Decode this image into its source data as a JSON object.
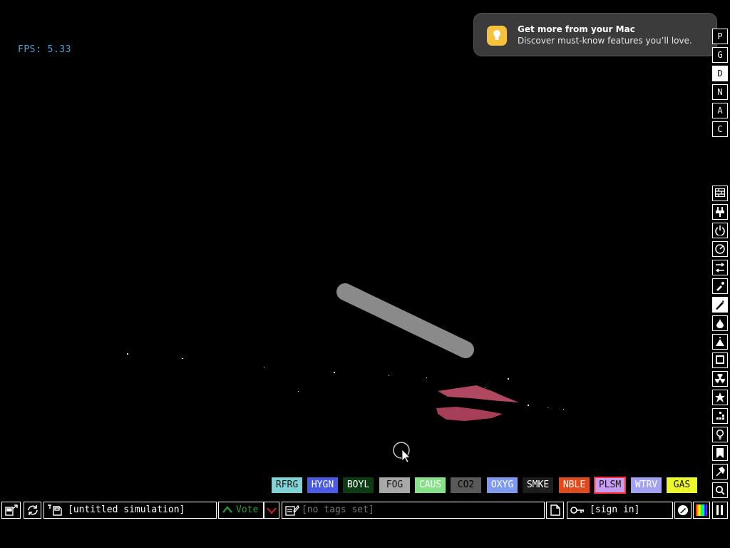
{
  "fps_label": "FPS: 5.33",
  "notification": {
    "title": "Get more from your Mac",
    "body": "Discover must-know features you’ll love.",
    "icon": "lightbulb-icon"
  },
  "display_modes": [
    "P",
    "G",
    "D",
    "N",
    "A",
    "C"
  ],
  "selected_display_mode": "D",
  "categories": [
    "walls-icon",
    "electronics-icon",
    "powered-icon",
    "sensors-icon",
    "force-icon",
    "explosives-icon",
    "gases-icon",
    "liquids-icon",
    "powders-icon",
    "solids-icon",
    "radioactive-icon",
    "special-icon",
    "life-icon",
    "tools-icon",
    "favorites-icon",
    "decoration-icon",
    "search-icon"
  ],
  "elements": [
    {
      "label": "RFRG",
      "bg": "#7fd2d6",
      "fg": "#1a1a1a"
    },
    {
      "label": "HYGN",
      "bg": "#4b5be8",
      "fg": "#ffffff"
    },
    {
      "label": "BOYL",
      "bg": "#0c3d12",
      "fg": "#ffffff"
    },
    {
      "label": "FOG",
      "bg": "#a8a8a8",
      "fg": "#1a1a1a"
    },
    {
      "label": "CAUS",
      "bg": "#88e08a",
      "fg": "#ffffff"
    },
    {
      "label": "CO2",
      "bg": "#595959",
      "fg": "#000000"
    },
    {
      "label": "OXYG",
      "bg": "#7f9bf0",
      "fg": "#ffffff"
    },
    {
      "label": "SMKE",
      "bg": "#1e1e1e",
      "fg": "#ffffff"
    },
    {
      "label": "NBLE",
      "bg": "#e04a1c",
      "fg": "#ffffff"
    },
    {
      "label": "PLSM",
      "bg": "#c79cf3",
      "fg": "#1a1a1a"
    },
    {
      "label": "WTRV",
      "bg": "#a3a1f2",
      "fg": "#ffffff"
    },
    {
      "label": "GAS",
      "bg": "#ecf82a",
      "fg": "#1a1a1a"
    }
  ],
  "selected_element": "PLSM",
  "bottom_bar": {
    "simulation_name": "[untitled simulation]",
    "vote_label": "Vote",
    "tags_label": "[no tags set]",
    "sign_in_label": "[sign in]"
  }
}
